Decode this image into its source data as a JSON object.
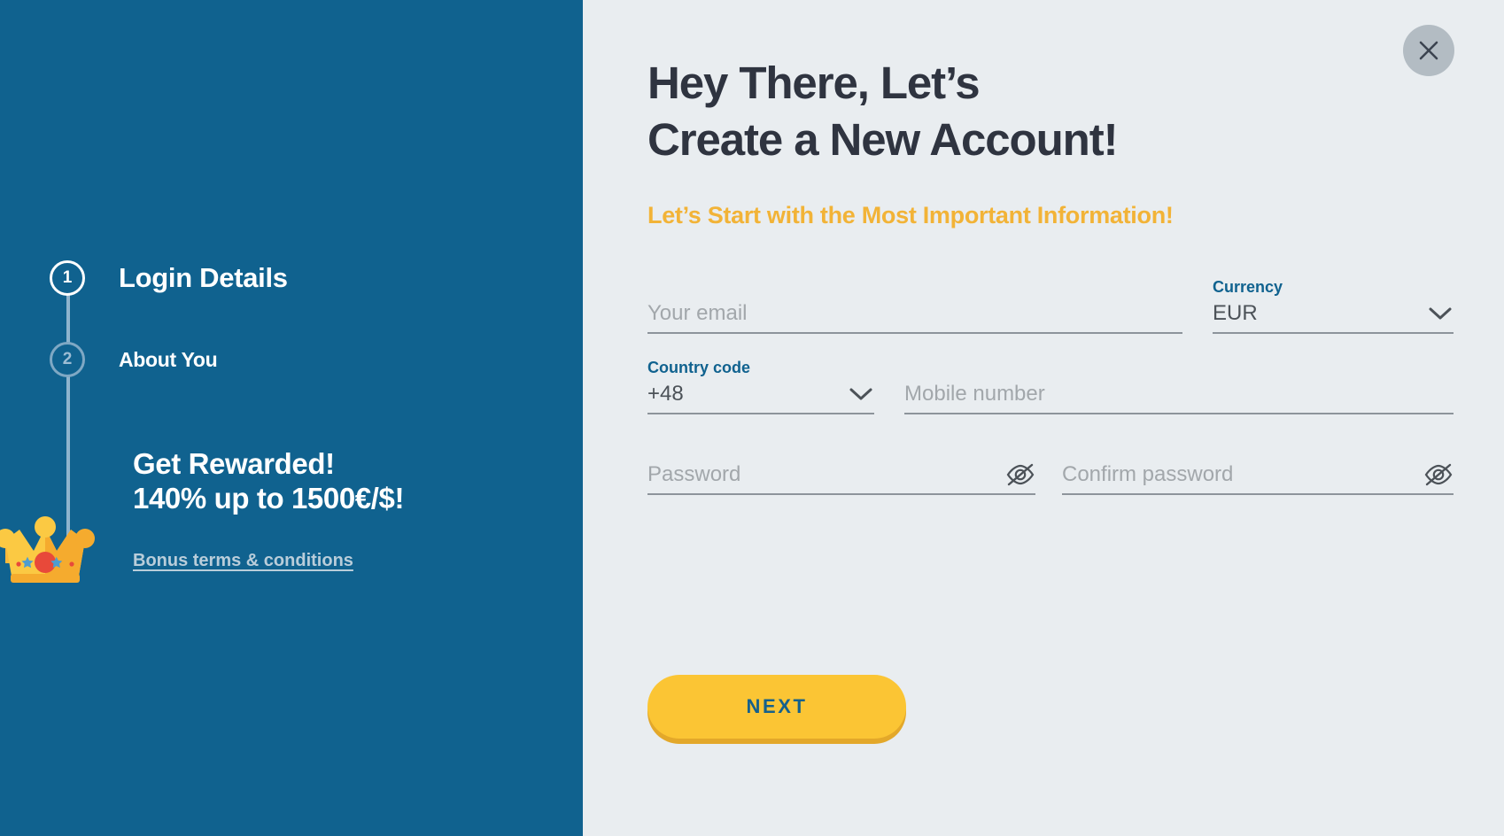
{
  "brand": {
    "panel_blue": "#10628f",
    "accent_yellow": "#fbc534",
    "subtitle_amber": "#f2b337",
    "page_bg": "#e9edf0",
    "heading_color": "#2f3440"
  },
  "sidebar": {
    "steps": [
      {
        "number": "1",
        "label": "Login Details",
        "state": "active"
      },
      {
        "number": "2",
        "label": "About You",
        "state": "inactive"
      }
    ],
    "reward": {
      "line1": "Get Rewarded!",
      "line2": "140% up to 1500€/$!"
    },
    "bonus_link": "Bonus terms & conditions",
    "crown_icon": "crown-icon"
  },
  "header": {
    "title_line1": "Hey There, Let’s",
    "title_line2": "Create a New Account!",
    "subtitle": "Let’s Start with the Most Important Information!",
    "close_icon": "close-icon"
  },
  "form": {
    "email": {
      "placeholder": "Your email",
      "value": ""
    },
    "currency": {
      "label": "Currency",
      "selected": "EUR",
      "chevron_icon": "chevron-down-icon"
    },
    "country_code": {
      "label": "Country code",
      "selected": "+48",
      "chevron_icon": "chevron-down-icon"
    },
    "mobile": {
      "placeholder": "Mobile number",
      "value": ""
    },
    "password": {
      "placeholder": "Password",
      "value": "",
      "toggle_icon": "eye-off-icon"
    },
    "confirm_password": {
      "placeholder": "Confirm password",
      "value": "",
      "toggle_icon": "eye-off-icon"
    },
    "submit_label": "NEXT"
  }
}
